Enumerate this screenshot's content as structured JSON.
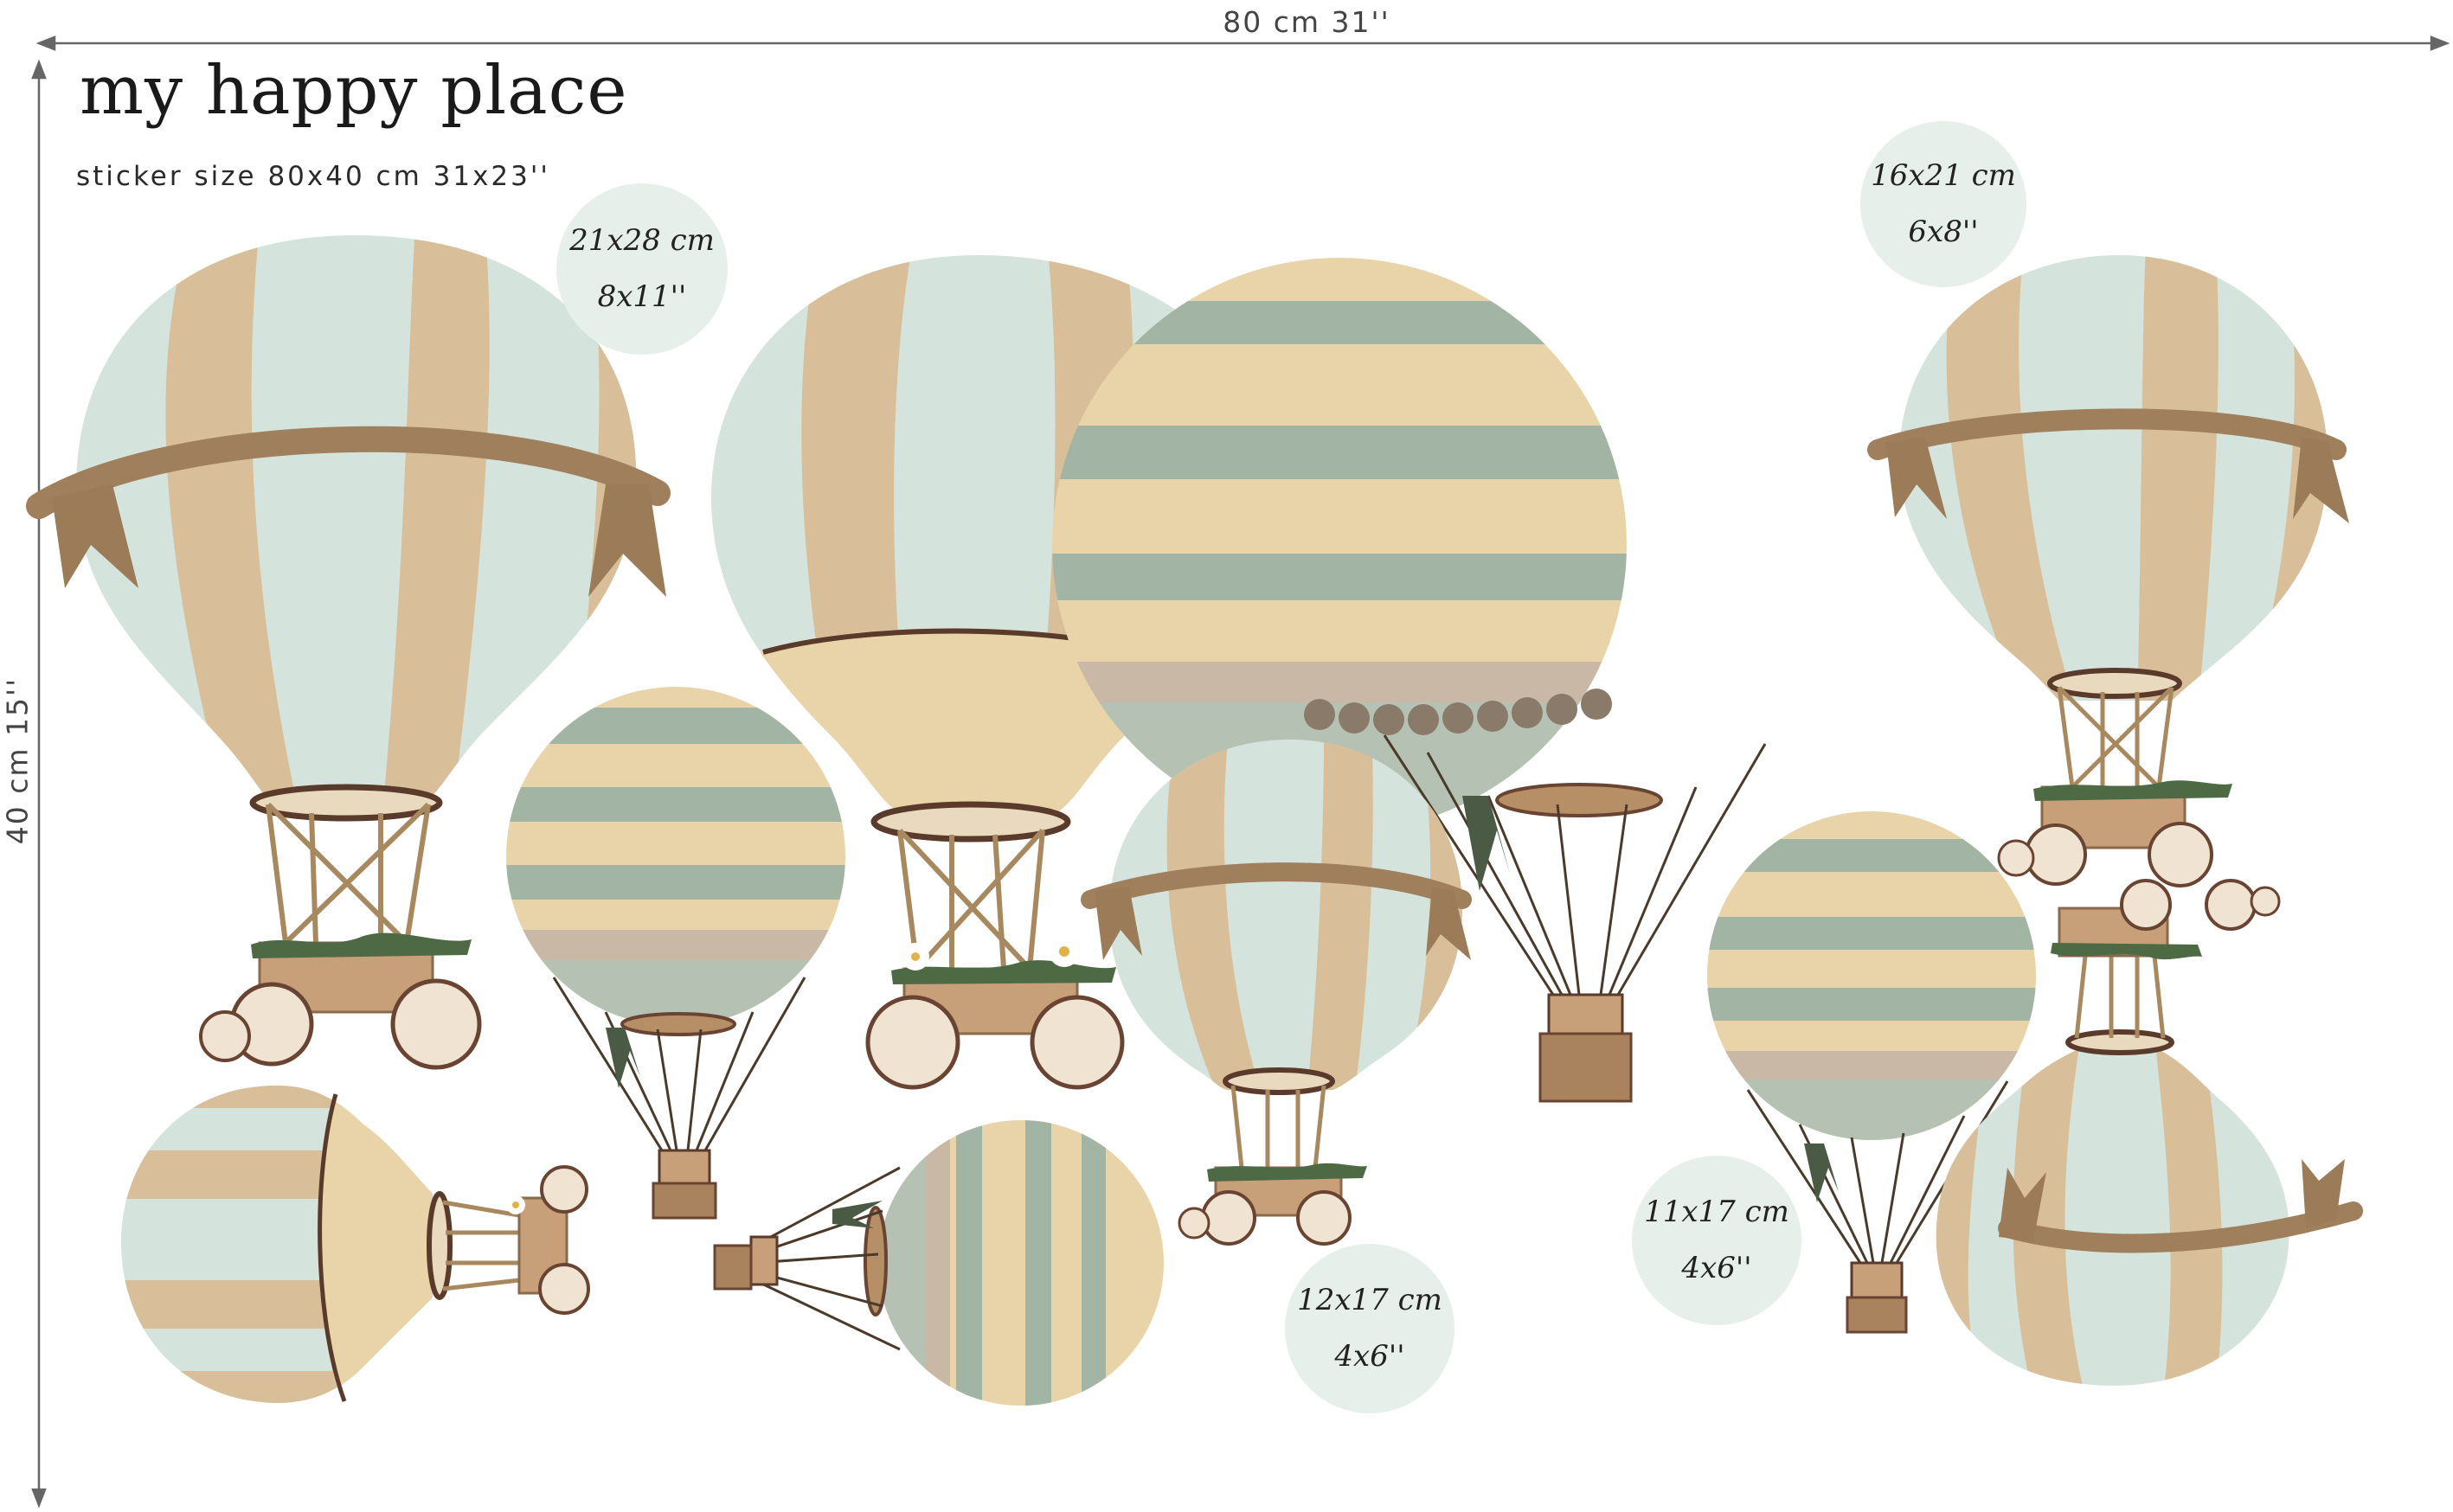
{
  "brand": {
    "title_part1": "my happy",
    "title_part2": "place",
    "accent_color": "#d89a3a"
  },
  "subtitle": "sticker size 80x40 cm 31x23''",
  "dimensions": {
    "width_label": "80 cm 31''",
    "height_label": "40 cm 15''"
  },
  "size_badges": [
    {
      "metric": "21x28 cm",
      "imperial": "8x11''"
    },
    {
      "metric": "16x21 cm",
      "imperial": "6x8''"
    },
    {
      "metric": "12x17 cm",
      "imperial": "4x6''"
    },
    {
      "metric": "11x17 cm",
      "imperial": "4x6''"
    }
  ],
  "palette": {
    "mint": "#d4e4dc",
    "tan": "#d8bf9a",
    "cream": "#e8d4a8",
    "sage": "#a2b5a5",
    "brown": "#8a6a4a",
    "dark_brown": "#5a3a2a",
    "badge_bg": "#e7efea"
  }
}
